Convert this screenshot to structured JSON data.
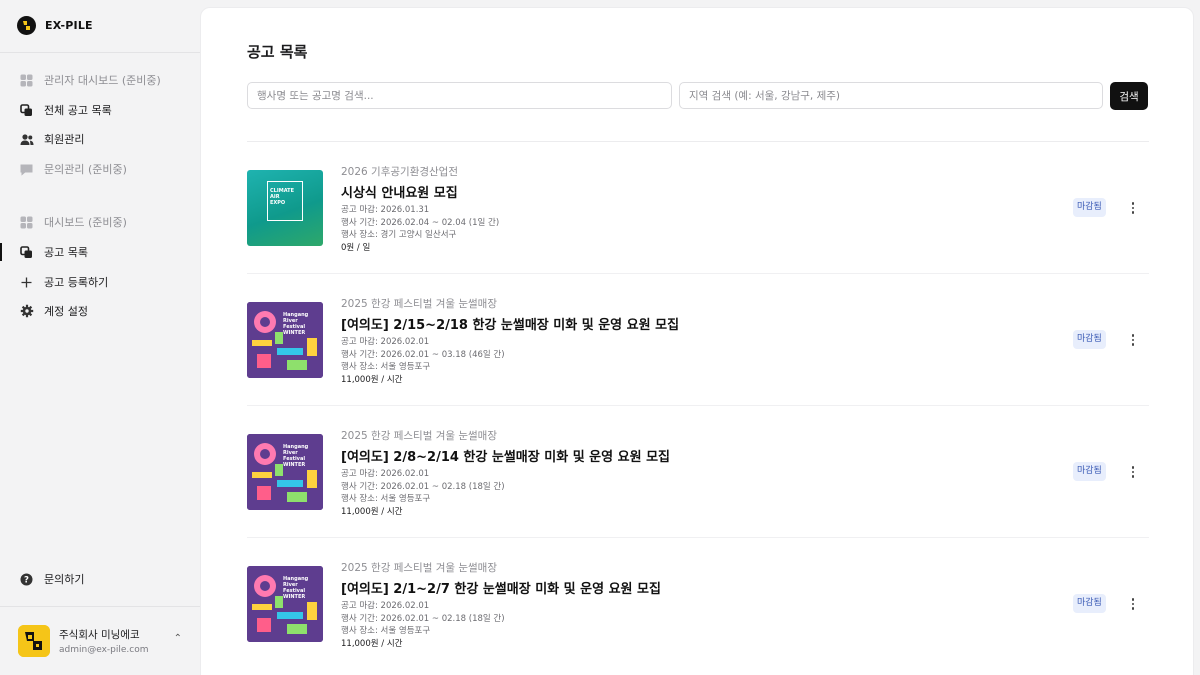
{
  "brand": {
    "name": "EX-PILE"
  },
  "sidebar": {
    "admin_items": [
      {
        "label": "관리자 대시보드 (준비중)",
        "icon": "grid-icon",
        "disabled": true
      },
      {
        "label": "전체 공고 목록",
        "icon": "copy-icon",
        "disabled": false
      },
      {
        "label": "회원관리",
        "icon": "users-icon",
        "disabled": false
      },
      {
        "label": "문의관리 (준비중)",
        "icon": "chat-icon",
        "disabled": true
      }
    ],
    "items": [
      {
        "label": "대시보드 (준비중)",
        "icon": "grid-icon",
        "disabled": true
      },
      {
        "label": "공고 목록",
        "icon": "copy-icon",
        "disabled": false,
        "active": true
      },
      {
        "label": "공고 등록하기",
        "icon": "plus-icon",
        "disabled": false
      },
      {
        "label": "계정 설정",
        "icon": "gear-icon",
        "disabled": false
      }
    ],
    "help_label": "문의하기",
    "account": {
      "name": "주식회사 미닝에코",
      "email": "admin@ex-pile.com"
    }
  },
  "main": {
    "title": "공고 목록",
    "search": {
      "keyword_placeholder": "행사명 또는 공고명 검색...",
      "region_placeholder": "지역 검색 (예: 서울, 강남구, 제주)",
      "button_label": "검색"
    },
    "jobs": [
      {
        "event": "2026 기후공기환경산업전",
        "title": "시상식 안내요원 모집",
        "deadline": "공고 마감: 2026.01.31",
        "period": "행사 기간: 2026.02.04 ~ 02.04 (1일 간)",
        "venue": "행사 장소: 경기 고양시 일산서구",
        "pay": "0원 / 일",
        "status": "마감됨",
        "thumb": "climate",
        "thumb_text": [
          "CLIMATE",
          "AIR",
          "EXPO"
        ]
      },
      {
        "event": "2025 한강 페스티벌 겨울 눈썰매장",
        "title": "[여의도] 2/15~2/18 한강 눈썰매장 미화 및 운영 요원 모집",
        "deadline": "공고 마감: 2026.02.01",
        "period": "행사 기간: 2026.02.01 ~ 03.18 (46일 간)",
        "venue": "행사 장소: 서울 영등포구",
        "pay": "11,000원 / 시간",
        "status": "마감됨",
        "thumb": "festival",
        "thumb_text": [
          "Hangang",
          "River",
          "Festival",
          "WINTER"
        ]
      },
      {
        "event": "2025 한강 페스티벌 겨울 눈썰매장",
        "title": "[여의도] 2/8~2/14 한강 눈썰매장 미화 및 운영 요원 모집",
        "deadline": "공고 마감: 2026.02.01",
        "period": "행사 기간: 2026.02.01 ~ 02.18 (18일 간)",
        "venue": "행사 장소: 서울 영등포구",
        "pay": "11,000원 / 시간",
        "status": "마감됨",
        "thumb": "festival",
        "thumb_text": [
          "Hangang",
          "River",
          "Festival",
          "WINTER"
        ]
      },
      {
        "event": "2025 한강 페스티벌 겨울 눈썰매장",
        "title": "[여의도] 2/1~2/7 한강 눈썰매장 미화 및 운영 요원 모집",
        "deadline": "공고 마감: 2026.02.01",
        "period": "행사 기간: 2026.02.01 ~ 02.18 (18일 간)",
        "venue": "행사 장소: 서울 영등포구",
        "pay": "11,000원 / 시간",
        "status": "마감됨",
        "thumb": "festival",
        "thumb_text": [
          "Hangang",
          "River",
          "Festival",
          "WINTER"
        ]
      }
    ]
  },
  "colors": {
    "accent": "#111111",
    "badge_bg": "#e8eefc",
    "badge_fg": "#3b5bb5",
    "climate_thumb": "#12a8a0",
    "festival_thumb": "#5b3b8c"
  }
}
